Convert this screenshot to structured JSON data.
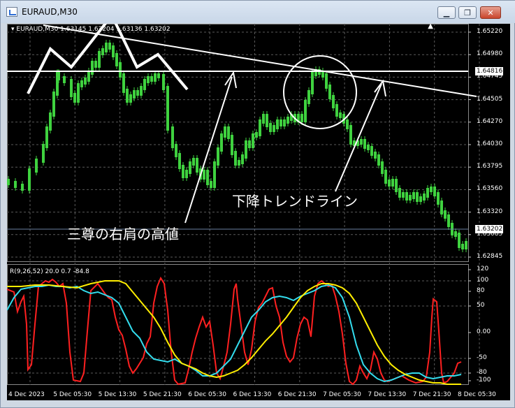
{
  "window": {
    "title": "EURAUD,M30",
    "minimize_glyph": "▁",
    "restore_glyph": "❐",
    "close_glyph": "✕"
  },
  "price_pane": {
    "label": "▾ EURAUD,M30  1.63145 1.63204 1.63136 1.63202",
    "y_ticks": [
      "1.65220",
      "1.64980",
      "1.64745",
      "1.64505",
      "1.64270",
      "1.64030",
      "1.63795",
      "1.63560",
      "1.63320",
      "1.63085",
      "1.62845"
    ],
    "current_price": "1.63202",
    "horizontal_line_price": "1.64816"
  },
  "indicator_pane": {
    "label": "R(9,26,52) 20.0 0.7 -84.8",
    "y_ticks": [
      "120",
      "100",
      "80",
      "50",
      "0.00",
      "-50",
      "-80",
      "-100"
    ]
  },
  "x_axis": {
    "labels": [
      "4 Dec 2023",
      "5 Dec 05:30",
      "5 Dec 13:30",
      "5 Dec 21:30",
      "6 Dec 05:30",
      "6 Dec 13:30",
      "6 Dec 21:30",
      "7 Dec 05:30",
      "7 Dec 13:30",
      "7 Dec 21:30",
      "8 Dec 05:30"
    ]
  },
  "annotations": {
    "trendline_label": "下降トレンドライン",
    "shoulder_label": "三尊の右肩の高値"
  },
  "colors": {
    "candle": "#3fd23f",
    "trendline": "#ffffff",
    "red_line": "#ff2020",
    "cyan_line": "#33ddee",
    "yellow_line": "#ffee00"
  }
}
